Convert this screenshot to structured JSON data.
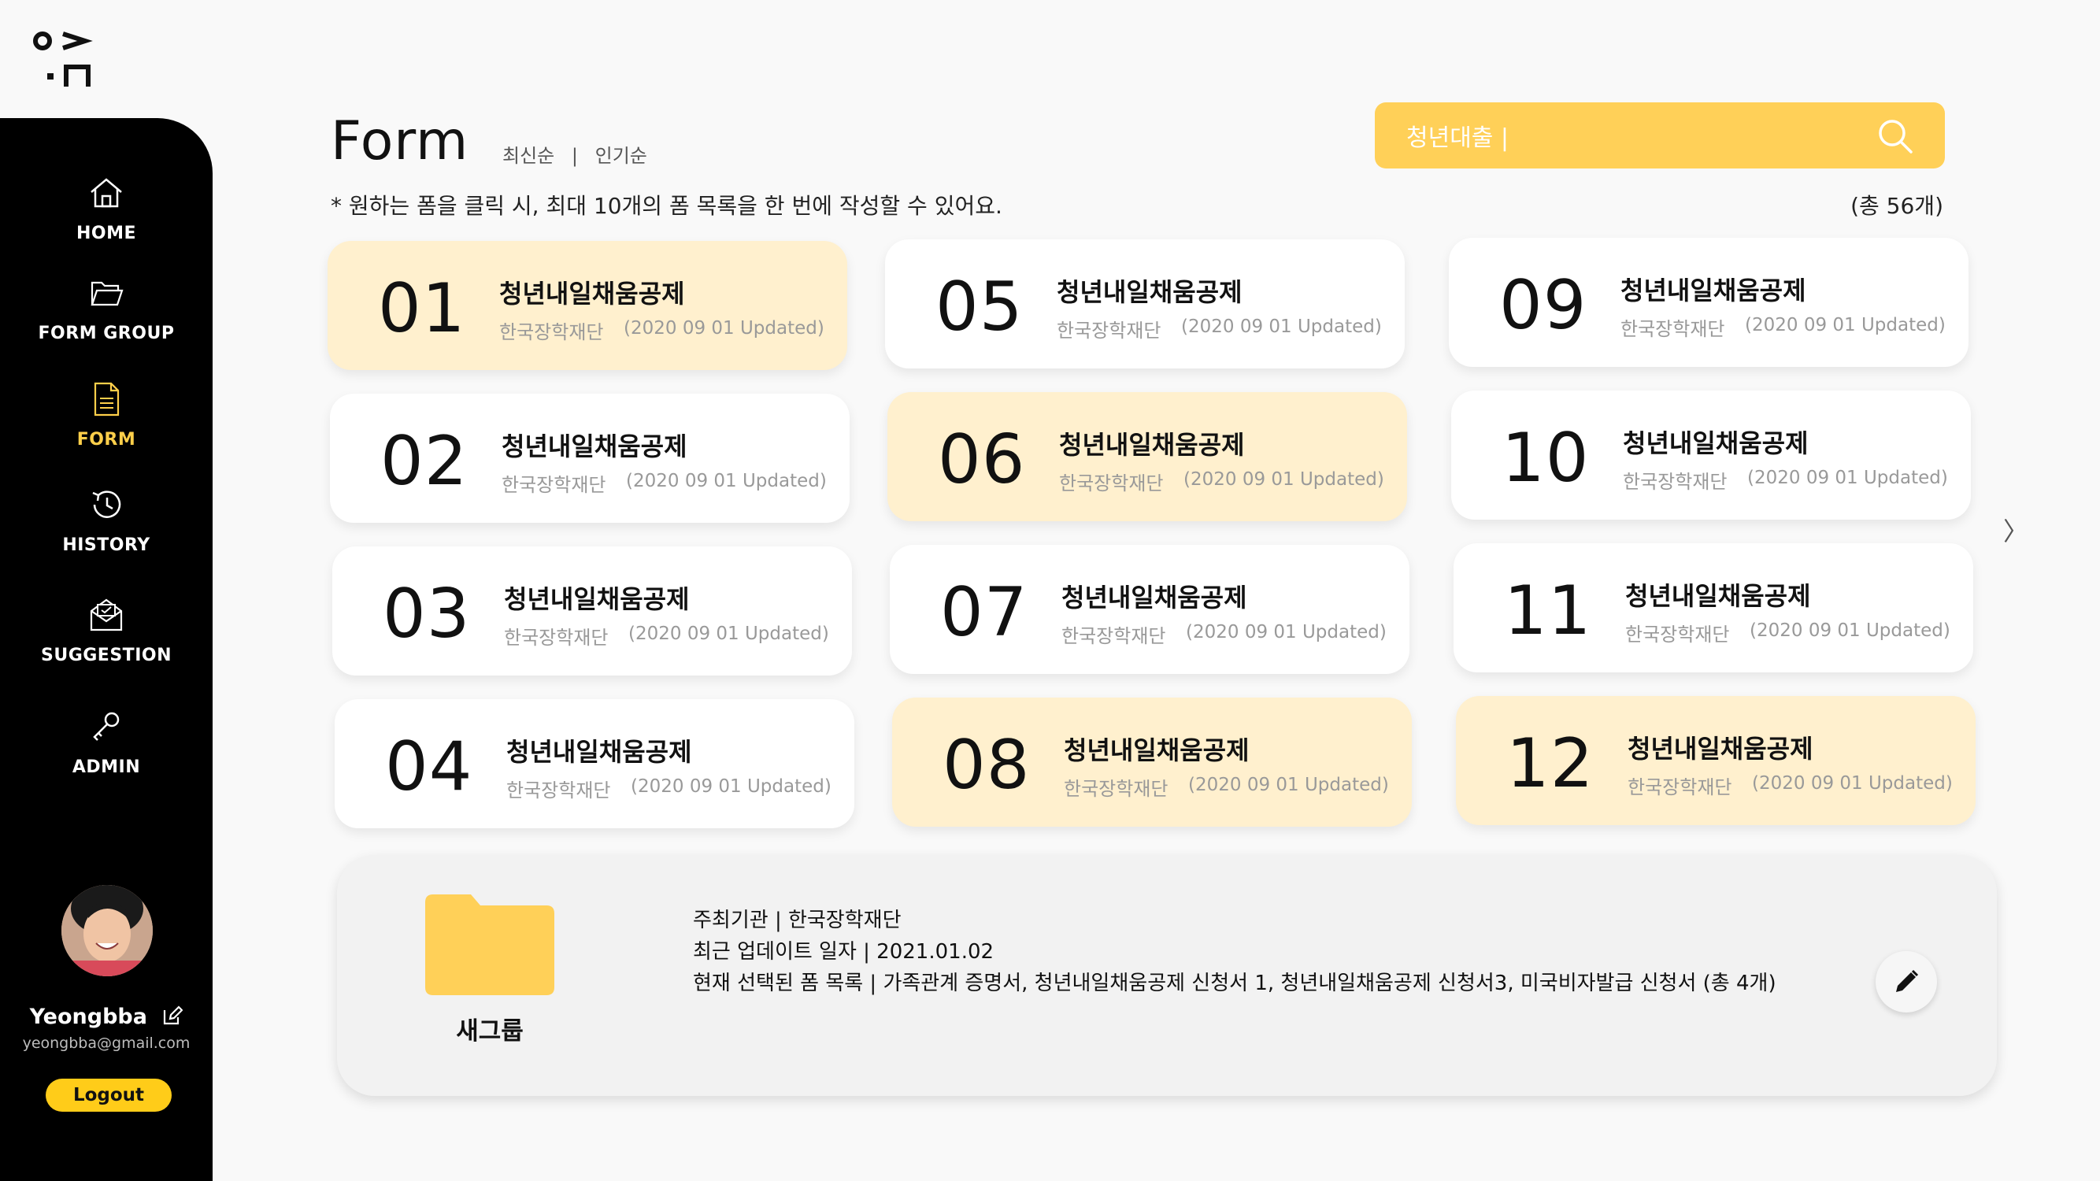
{
  "sidebar": {
    "items": [
      {
        "label": "HOME",
        "icon": "home-icon"
      },
      {
        "label": "FORM GROUP",
        "icon": "folder-open-icon"
      },
      {
        "label": "FORM",
        "icon": "document-icon",
        "active": true
      },
      {
        "label": "HISTORY",
        "icon": "history-icon"
      },
      {
        "label": "SUGGESTION",
        "icon": "mail-icon"
      },
      {
        "label": "ADMIN",
        "icon": "key-icon"
      }
    ],
    "user": {
      "name": "Yeongbba",
      "email": "yeongbba@gmail.com"
    },
    "logout_label": "Logout"
  },
  "header": {
    "title": "Form",
    "sort_latest": "최신순",
    "sort_sep": "|",
    "sort_popular": "인기순",
    "hint": "* 원하는 폼을 클릭 시, 최대 10개의 폼 목록을 한 번에 작성할 수 있어요.",
    "total": "(총 56개)"
  },
  "search": {
    "value": "청년대출 |",
    "icon": "search-icon"
  },
  "cards": [
    {
      "num": "01",
      "title": "청년내일채움공제",
      "org": "한국장학재단",
      "updated": "(2020 09 01 Updated)",
      "selected": true
    },
    {
      "num": "02",
      "title": "청년내일채움공제",
      "org": "한국장학재단",
      "updated": "(2020 09 01 Updated)",
      "selected": false
    },
    {
      "num": "03",
      "title": "청년내일채움공제",
      "org": "한국장학재단",
      "updated": "(2020 09 01 Updated)",
      "selected": false
    },
    {
      "num": "04",
      "title": "청년내일채움공제",
      "org": "한국장학재단",
      "updated": "(2020 09 01 Updated)",
      "selected": false
    },
    {
      "num": "05",
      "title": "청년내일채움공제",
      "org": "한국장학재단",
      "updated": "(2020 09 01 Updated)",
      "selected": false
    },
    {
      "num": "06",
      "title": "청년내일채움공제",
      "org": "한국장학재단",
      "updated": "(2020 09 01 Updated)",
      "selected": true
    },
    {
      "num": "07",
      "title": "청년내일채움공제",
      "org": "한국장학재단",
      "updated": "(2020 09 01 Updated)",
      "selected": false
    },
    {
      "num": "08",
      "title": "청년내일채움공제",
      "org": "한국장학재단",
      "updated": "(2020 09 01 Updated)",
      "selected": true
    },
    {
      "num": "09",
      "title": "청년내일채움공제",
      "org": "한국장학재단",
      "updated": "(2020 09 01 Updated)",
      "selected": false
    },
    {
      "num": "10",
      "title": "청년내일채움공제",
      "org": "한국장학재단",
      "updated": "(2020 09 01 Updated)",
      "selected": false
    },
    {
      "num": "11",
      "title": "청년내일채움공제",
      "org": "한국장학재단",
      "updated": "(2020 09 01 Updated)",
      "selected": false
    },
    {
      "num": "12",
      "title": "청년내일채움공제",
      "org": "한국장학재단",
      "updated": "(2020 09 01 Updated)",
      "selected": true
    }
  ],
  "next_arrow": "〉",
  "group": {
    "folder_label": "새그룹",
    "host": "주최기관  |  한국장학재단",
    "last_update": "최근 업데이트 일자 | 2021.01.02",
    "selected_forms": "현재 선택된 폼 목록  | 가족관계 증명서, 청년내일채움공제 신청서 1, 청년내일채움공제 신청서3, 미국비자발급 신청서 (총 4개)"
  },
  "colors": {
    "accent": "#ffd058",
    "selected_card": "#fff0ce",
    "sidebar": "#000000",
    "active_nav": "#ffcf4a"
  }
}
